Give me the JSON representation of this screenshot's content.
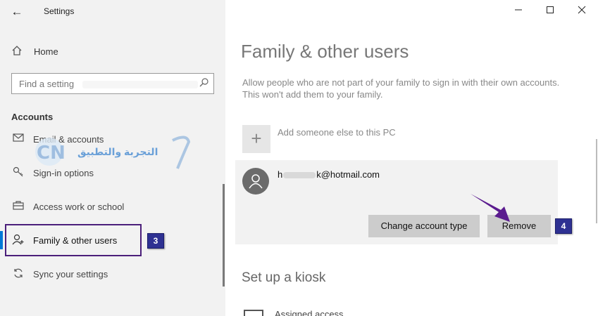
{
  "window": {
    "title": "Settings",
    "back_glyph": "←",
    "minimize_glyph": "—",
    "maximize_glyph": "☐",
    "close_glyph": "✕"
  },
  "sidebar": {
    "home_label": "Home",
    "search_placeholder": "Find a setting",
    "section_header": "Accounts",
    "items": [
      {
        "label": "Email & accounts",
        "icon": "email-icon"
      },
      {
        "label": "Sign-in options",
        "icon": "key-icon"
      },
      {
        "label": "Access work or school",
        "icon": "briefcase-icon"
      },
      {
        "label": "Family & other users",
        "icon": "add-person-icon",
        "selected": true
      },
      {
        "label": "Sync your settings",
        "icon": "sync-icon"
      }
    ],
    "watermark_text": "التجربة والتطبيق",
    "watermark_logo": "CN"
  },
  "main": {
    "title": "Family & other users",
    "description": "Allow people who are not part of your family to sign in with their own accounts. This won't add them to your family.",
    "add_label": "Add someone else to this PC",
    "user": {
      "email_prefix": "h",
      "email_suffix": "k@hotmail.com"
    },
    "buttons": {
      "change_type": "Change account type",
      "remove": "Remove"
    },
    "kiosk_header": "Set up a kiosk",
    "assigned_access": "Assigned access"
  },
  "annotations": {
    "step3": "3",
    "step4": "4",
    "highlight_color": "#4b1f7a",
    "badge_color": "#2e3192",
    "arrow_color": "#5b1c8f"
  },
  "colors": {
    "accent": "#0078d7",
    "sidebar_bg": "#f2f2f2",
    "button_bg": "#cccccc"
  }
}
